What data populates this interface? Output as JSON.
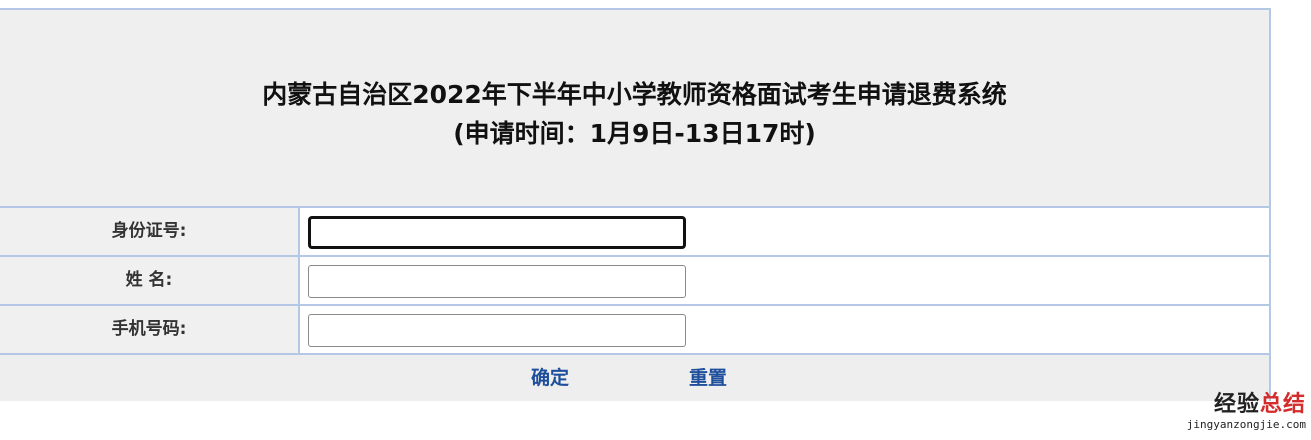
{
  "header": {
    "title": "内蒙古自治区2022年下半年中小学教师资格面试考生申请退费系统",
    "subtitle": "(申请时间：1月9日-13日17时)"
  },
  "form": {
    "fields": [
      {
        "label": "身份证号:",
        "value": "",
        "placeholder": ""
      },
      {
        "label": "姓 名:",
        "value": "",
        "placeholder": ""
      },
      {
        "label": "手机号码:",
        "value": "",
        "placeholder": ""
      }
    ],
    "submit_label": "确定",
    "reset_label": "重置"
  },
  "watermark": {
    "main_dark": "经验",
    "main_red": "总结",
    "sub": "jingyanzongjie.com"
  },
  "colors": {
    "header_bg": "#efefef",
    "border": "#b4c8e6",
    "link": "#1e4f9c",
    "watermark_accent": "#d42b2b"
  }
}
